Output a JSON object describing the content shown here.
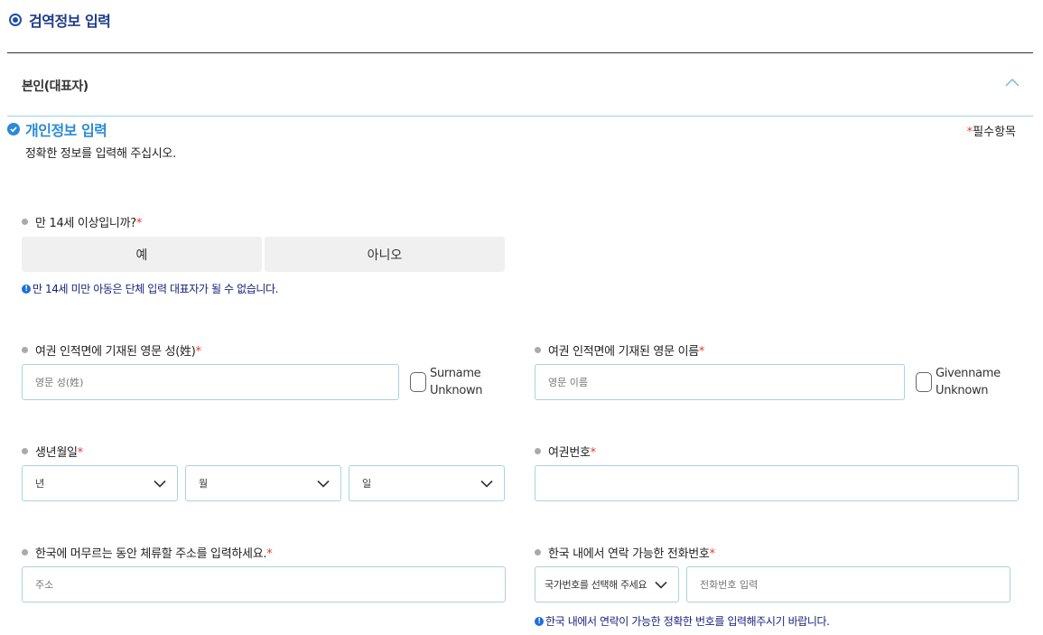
{
  "section": {
    "title": "검역정보 입력"
  },
  "accordion": {
    "title": "본인(대표자)"
  },
  "personal": {
    "title": "개인정보 입력",
    "required_star": "*",
    "required_label": "필수항목",
    "instruction": "정확한 정보를 입력해 주십시오."
  },
  "age_question": {
    "label": "만 14세 이상입니까?",
    "star": "*",
    "yes": "예",
    "no": "아니오",
    "info": "만 14세 미만 아동은 단체 입력 대표자가 될 수 없습니다."
  },
  "surname": {
    "label": "여권 인적면에 기재된 영문 성(姓)",
    "star": "*",
    "placeholder": "영문 성(姓)",
    "unknown_line1": "Surname",
    "unknown_line2": "Unknown"
  },
  "givenname": {
    "label": "여권 인적면에 기재된 영문 이름",
    "star": "*",
    "placeholder": "영문 이름",
    "unknown_line1": "Givenname",
    "unknown_line2": "Unknown"
  },
  "birth": {
    "label": "생년월일",
    "star": "*",
    "year": "년",
    "month": "월",
    "day": "일"
  },
  "passport": {
    "label": "여권번호",
    "star": "*",
    "value": ""
  },
  "address": {
    "label": "한국에 머무르는 동안 체류할 주소를 입력하세요.",
    "star": "*",
    "placeholder": "주소"
  },
  "phone": {
    "label": "한국 내에서 연락 가능한 전화번호",
    "star": "*",
    "country_placeholder": "국가번호를 선택해 주세요",
    "number_placeholder": "전화번호 입력",
    "info": "한국 내에서 연락이 가능한 정확한 번호를 입력해주시기 바랍니다."
  },
  "colors": {
    "primary_dark": "#1f3c88",
    "primary": "#2b8ad6",
    "required": "#e53935",
    "border": "#a9d3e0",
    "info_text": "#1a237e"
  },
  "icons": {
    "section": "radio-dot-icon",
    "subsection": "check-circle-icon",
    "accordion": "chevron-up-icon",
    "select": "chevron-down-icon",
    "info": "info-icon"
  }
}
